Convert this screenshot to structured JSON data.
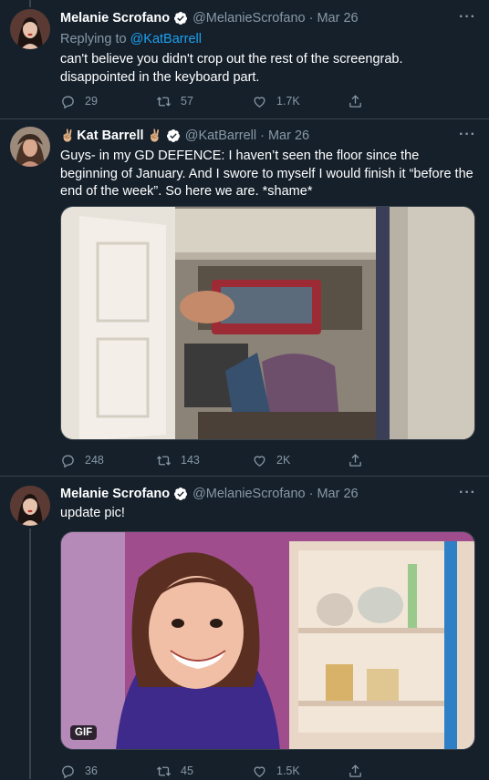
{
  "tweets": [
    {
      "name": "Melanie Scrofano",
      "handle": "@MelanieScrofano",
      "date": "· Mar 26",
      "reply_label": "Replying to",
      "reply_mention": "@KatBarrell",
      "text": "can't believe you didn't crop out the rest of the screengrab. disappointed in the keyboard part.",
      "replies": "29",
      "retweets": "57",
      "likes": "1.7K"
    },
    {
      "name": "Kat Barrell",
      "name_prefix_emoji": "✌🏼",
      "name_suffix_emoji": "✌🏼",
      "handle": "@KatBarrell",
      "date": "· Mar 26",
      "text": "Guys- in my GD DEFENCE: I haven’t seen the floor since the beginning of January.  And I swore to myself I would finish it “before the end of the week”. So here we are. *shame*",
      "replies": "248",
      "retweets": "143",
      "likes": "2K"
    },
    {
      "name": "Melanie Scrofano",
      "handle": "@MelanieScrofano",
      "date": "· Mar 26",
      "text": "update pic!",
      "gif_label": "GIF",
      "replies": "36",
      "retweets": "45",
      "likes": "1.5K"
    }
  ],
  "more_glyph": "···",
  "colors": {
    "background": "#15202b",
    "secondary_text": "#8899a6",
    "accent": "#1da1f2",
    "border": "#38444d"
  },
  "icons": [
    "verified-badge-icon",
    "reply-icon",
    "retweet-icon",
    "like-icon",
    "share-icon",
    "more-icon"
  ]
}
